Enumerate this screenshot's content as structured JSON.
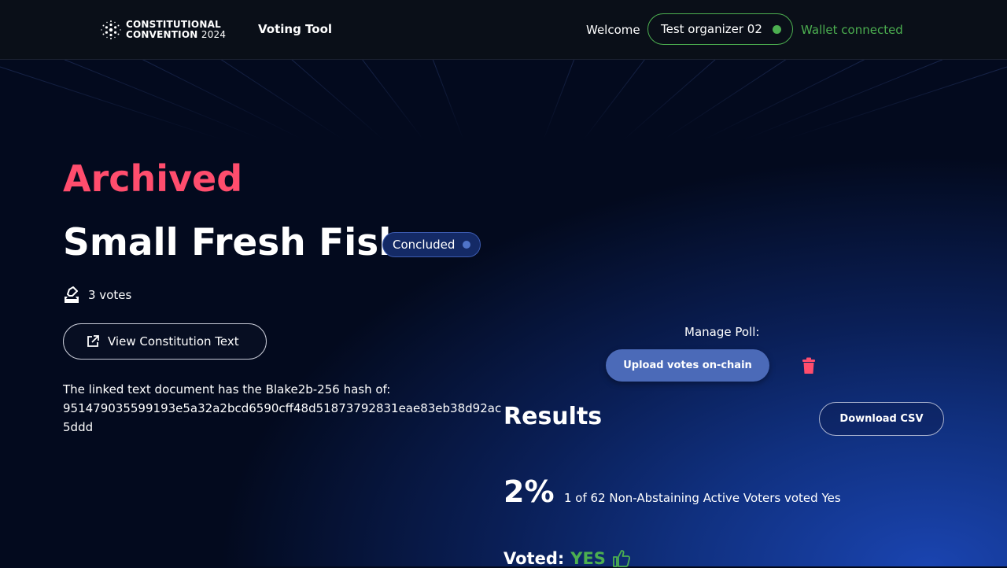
{
  "header": {
    "logo_line1": "CONSTITUTIONAL",
    "logo_line2": "CONVENTION",
    "logo_year": "2024",
    "app_name": "Voting Tool",
    "welcome": "Welcome",
    "user_name": "Test organizer 02",
    "wallet_status": "Wallet connected"
  },
  "poll": {
    "archived_label": "Archived",
    "title": "Small Fresh Fish",
    "status": "Concluded",
    "votes": "3 votes",
    "view_text_label": "View Constitution Text",
    "hash_label": "The linked text document has the Blake2b-256 hash of:",
    "hash_value": "951479035599193e5a32a2bcd6590cff48d51873792831eae83eb38d92ac5ddd"
  },
  "manage": {
    "label": "Manage Poll:",
    "upload_label": "Upload votes on-chain"
  },
  "results": {
    "heading": "Results",
    "download_label": "Download CSV",
    "percent": "2%",
    "summary": "1 of 62 Non-Abstaining Active Voters voted Yes",
    "voted_label": "Voted:",
    "voted_value": "YES"
  },
  "colors": {
    "accent_red": "#ff4d6d",
    "accent_green": "#4caf50",
    "primary_blue": "#4b6ab8"
  }
}
